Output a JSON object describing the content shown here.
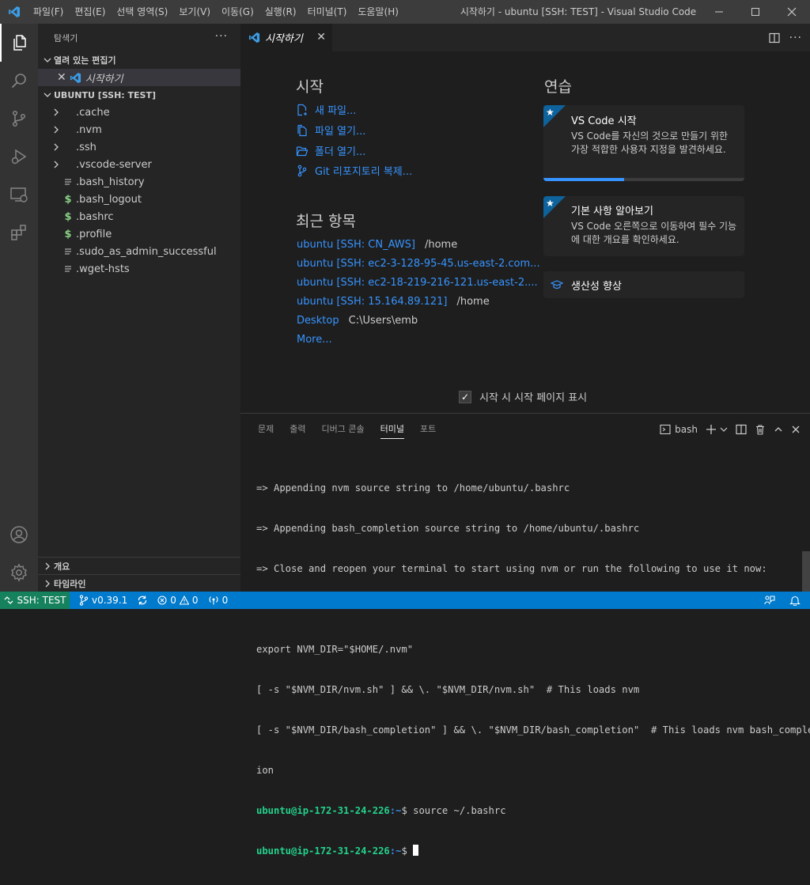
{
  "titlebar": {
    "menu": [
      "파일(F)",
      "편집(E)",
      "선택 영역(S)",
      "보기(V)",
      "이동(G)",
      "실행(R)",
      "터미널(T)",
      "도움말(H)"
    ],
    "window_title": "시작하기 - ubuntu [SSH: TEST] - Visual Studio Code"
  },
  "sidebar": {
    "title": "탐색기",
    "open_editors_label": "열려 있는 편집기",
    "open_editor_item": "시작하기",
    "folder_label": "UBUNTU [SSH: TEST]",
    "items": [
      {
        "label": ".cache",
        "type": "folder"
      },
      {
        "label": ".nvm",
        "type": "folder"
      },
      {
        "label": ".ssh",
        "type": "folder"
      },
      {
        "label": ".vscode-server",
        "type": "folder"
      },
      {
        "label": ".bash_history",
        "type": "file"
      },
      {
        "label": ".bash_logout",
        "type": "shell"
      },
      {
        "label": ".bashrc",
        "type": "shell"
      },
      {
        "label": ".profile",
        "type": "shell"
      },
      {
        "label": ".sudo_as_admin_successful",
        "type": "file"
      },
      {
        "label": ".wget-hsts",
        "type": "file"
      }
    ],
    "outline_label": "개요",
    "timeline_label": "타임라인"
  },
  "editor": {
    "tab_label": "시작하기",
    "start_heading": "시작",
    "start_links": [
      {
        "label": "새 파일...",
        "icon": "new-file-icon"
      },
      {
        "label": "파일 열기...",
        "icon": "open-file-icon"
      },
      {
        "label": "폴더 열기...",
        "icon": "open-folder-icon"
      },
      {
        "label": "Git 리포지토리 복제...",
        "icon": "git-clone-icon"
      }
    ],
    "recent_heading": "최근 항목",
    "recent": [
      {
        "name": "ubuntu [SSH: CN_AWS]",
        "path": "/home"
      },
      {
        "name": "ubuntu [SSH: ec2-3-128-95-45.us-east-2.com...",
        "path": ""
      },
      {
        "name": "ubuntu [SSH: ec2-18-219-216-121.us-east-2....",
        "path": ""
      },
      {
        "name": "ubuntu [SSH: 15.164.89.121]",
        "path": "/home"
      },
      {
        "name": "Desktop",
        "path": "C:\\Users\\emb"
      }
    ],
    "more_label": "More...",
    "walkthrough_heading": "연습",
    "card1": {
      "title": "VS Code 시작",
      "desc": "VS Code를 자신의 것으로 만들기 위한 가장 적합한 사용자 지정을 발견하세요.",
      "progress": 0.4
    },
    "card2": {
      "title": "기본 사항 알아보기",
      "desc": "VS Code 오른쪽으로 이동하여 필수 기능에 대한 개요를 확인하세요."
    },
    "card3": {
      "title": "생산성 향상"
    },
    "show_on_startup": "시작 시 시작 페이지 표시"
  },
  "panel": {
    "tabs": [
      "문제",
      "출력",
      "디버그 콘솔",
      "터미널",
      "포트"
    ],
    "active_tab": "터미널",
    "shell_label": "bash",
    "terminal_lines": [
      "=> Appending nvm source string to /home/ubuntu/.bashrc",
      "=> Appending bash_completion source string to /home/ubuntu/.bashrc",
      "=> Close and reopen your terminal to start using nvm or run the following to use it now:",
      "",
      "export NVM_DIR=\"$HOME/.nvm\"",
      "[ -s \"$NVM_DIR/nvm.sh\" ] && \\. \"$NVM_DIR/nvm.sh\"  # This loads nvm",
      "[ -s \"$NVM_DIR/bash_completion\" ] && \\. \"$NVM_DIR/bash_completion\"  # This loads nvm bash_complet",
      "ion"
    ],
    "prompt_user": "ubuntu@ip-172-31-24-226",
    "prompt_path": ":~",
    "prompt_sym": "$",
    "command": " source ~/.bashrc"
  },
  "statusbar": {
    "remote": "SSH: TEST",
    "branch": "v0.39.1",
    "errors": "0",
    "warnings": "0",
    "ports": "0"
  }
}
